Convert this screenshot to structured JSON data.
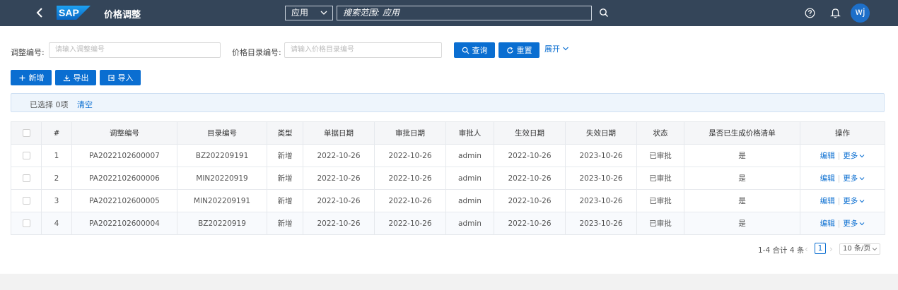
{
  "header": {
    "title": "价格调整",
    "logo_text": "SAP",
    "scope": "应用",
    "search_placeholder": "搜索范围: 应用",
    "avatar": "wj"
  },
  "filters": {
    "adjust_no_label": "调整编号:",
    "adjust_no_placeholder": "请输入调整编号",
    "catalog_no_label": "价格目录编号:",
    "catalog_no_placeholder": "请输入价格目录编号",
    "query_label": "查询",
    "reset_label": "重置",
    "expand_label": "展开"
  },
  "toolbar": {
    "add_label": "新增",
    "export_label": "导出",
    "import_label": "导入"
  },
  "selection": {
    "selected_text": "已选择 0项",
    "clear_label": "清空"
  },
  "table": {
    "columns": [
      "#",
      "调整编号",
      "目录编号",
      "类型",
      "单据日期",
      "审批日期",
      "审批人",
      "生效日期",
      "失效日期",
      "状态",
      "是否已生成价格清单",
      "操作"
    ],
    "rows": [
      [
        "1",
        "PA2022102600007",
        "BZ202209191",
        "新增",
        "2022-10-26",
        "2022-10-26",
        "admin",
        "2022-10-26",
        "2023-10-26",
        "已审批",
        "是"
      ],
      [
        "2",
        "PA2022102600006",
        "MIN20220919",
        "新增",
        "2022-10-26",
        "2022-10-26",
        "admin",
        "2022-10-26",
        "2023-10-26",
        "已审批",
        "是"
      ],
      [
        "3",
        "PA2022102600005",
        "MIN202209191",
        "新增",
        "2022-10-26",
        "2022-10-26",
        "admin",
        "2022-10-26",
        "2023-10-26",
        "已审批",
        "是"
      ],
      [
        "4",
        "PA2022102600004",
        "BZ20220919",
        "新增",
        "2022-10-26",
        "2022-10-26",
        "admin",
        "2022-10-26",
        "2023-10-26",
        "已审批",
        "是"
      ]
    ],
    "edit_label": "编辑",
    "more_label": "更多"
  },
  "pagination": {
    "total": "1-4 合计 4 条",
    "current_page": "1",
    "page_size": "10 条/页"
  },
  "colors": {
    "header_bg": "#344559",
    "primary": "#0a6ed1"
  }
}
